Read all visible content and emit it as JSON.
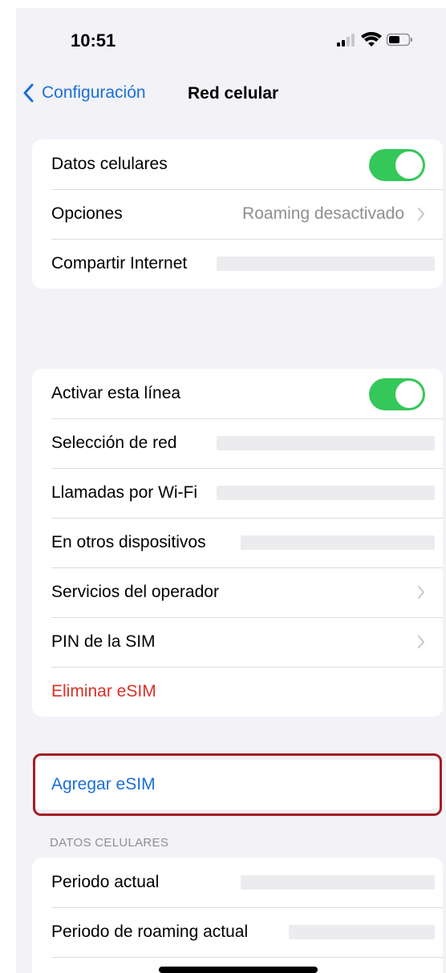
{
  "status": {
    "time": "10:51"
  },
  "nav": {
    "back_label": "Configuración",
    "title": "Red celular"
  },
  "group1": {
    "cellular_data": {
      "label": "Datos celulares",
      "enabled": true
    },
    "options": {
      "label": "Opciones",
      "value": "Roaming desactivado"
    },
    "hotspot": {
      "label": "Compartir Internet"
    }
  },
  "group2": {
    "activate_line": {
      "label": "Activar esta línea",
      "enabled": true
    },
    "network_selection": {
      "label": "Selección de red"
    },
    "wifi_calling": {
      "label": "Llamadas por Wi-Fi"
    },
    "other_devices": {
      "label": "En otros dispositivos"
    },
    "carrier_services": {
      "label": "Servicios del operador"
    },
    "sim_pin": {
      "label": "PIN de la SIM"
    },
    "delete_esim": {
      "label": "Eliminar eSIM"
    }
  },
  "add_esim": {
    "label": "Agregar eSIM"
  },
  "cellular_data_section": {
    "header": "DATOS CELULARES",
    "current_period": {
      "label": "Periodo actual"
    },
    "current_roaming_period": {
      "label": "Periodo de roaming actual"
    }
  },
  "colors": {
    "accent": "#1a6fd9",
    "toggle_on": "#34c759",
    "destructive": "#d93025",
    "highlight_border": "#a41d25"
  },
  "icons": [
    "signal-icon",
    "wifi-icon",
    "battery-icon",
    "chevron-left-icon",
    "chevron-right-icon"
  ]
}
